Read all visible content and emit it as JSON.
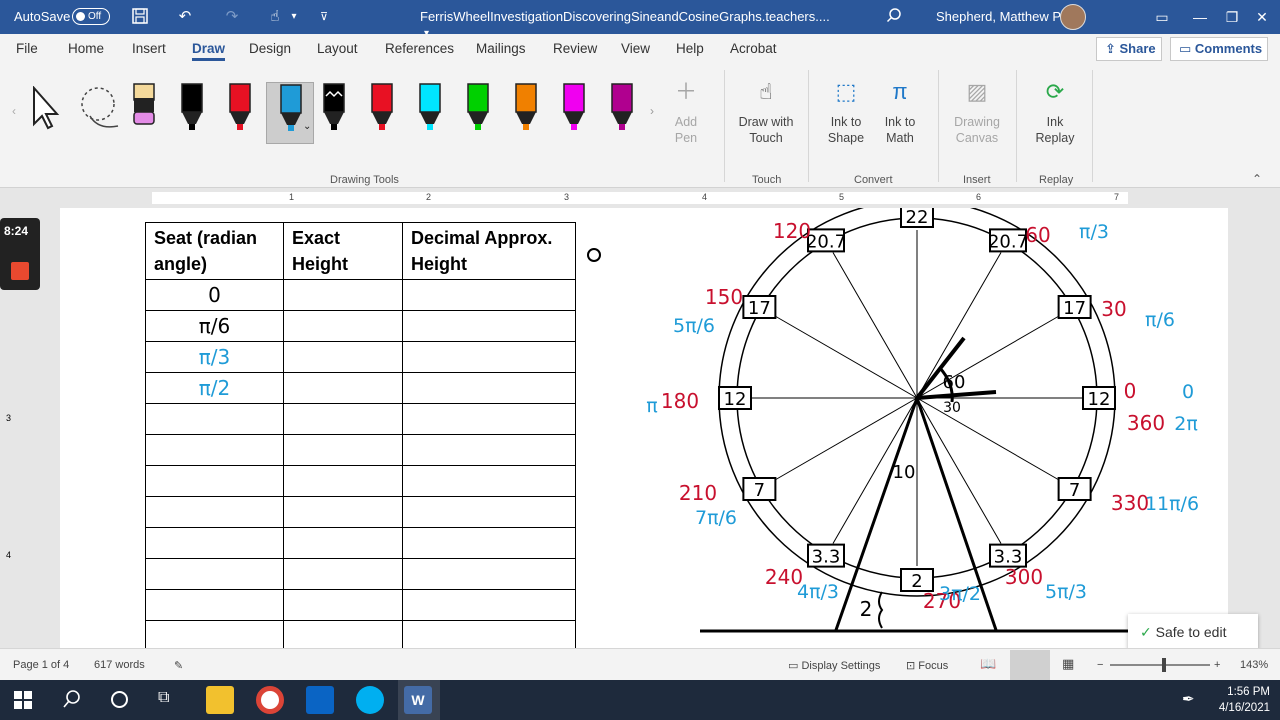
{
  "titlebar": {
    "autosave_label": "AutoSave",
    "autosave_state": "Off",
    "document_title": "FerrisWheelInvestigationDiscoveringSineandCosineGraphs.teachers....",
    "user_name": "Shepherd, Matthew P"
  },
  "tabs": [
    "File",
    "Home",
    "Insert",
    "Draw",
    "Design",
    "Layout",
    "References",
    "Mailings",
    "Review",
    "View",
    "Help",
    "Acrobat"
  ],
  "active_tab": "Draw",
  "share_label": "Share",
  "comments_label": "Comments",
  "ribbon": {
    "add_pen": "Add Pen",
    "draw_touch": "Draw with Touch",
    "ink_shape": "Ink to Shape",
    "ink_math": "Ink to Math",
    "drawing_canvas": "Drawing Canvas",
    "ink_replay": "Ink Replay",
    "groups": {
      "drawing_tools": "Drawing Tools",
      "touch": "Touch",
      "convert": "Convert",
      "insert": "Insert",
      "replay": "Replay"
    },
    "pen_colors": [
      "#000000",
      "#e81123",
      "#1f9bd7",
      "#000000",
      "#e81123",
      "#00e5ff",
      "#00d000",
      "#f08000",
      "#f000f0",
      "#b0008f"
    ]
  },
  "ruler_numbers": [
    "1",
    "2",
    "3",
    "4",
    "5",
    "6",
    "7"
  ],
  "vruler_numbers": [
    "3",
    "4"
  ],
  "timer": "8:24",
  "table": {
    "headers": [
      "Seat (radian angle)",
      "Exact Height",
      "Decimal Approx. Height"
    ],
    "rows": [
      "0",
      "π/6",
      "π/3",
      "π/2",
      "",
      "",
      "",
      "",
      "",
      "",
      "",
      ""
    ]
  },
  "wheel": {
    "seat_heights": {
      "top": "22",
      "upper_right": "20.7",
      "upper_left": "20.7",
      "right_high": "17",
      "left_high": "17",
      "right": "12",
      "left": "12",
      "right_low": "7",
      "left_low": "7",
      "lower_right": "3.3",
      "lower_left": "3.3",
      "bottom": "2"
    },
    "degree_labels": [
      "120",
      "60",
      "150",
      "30",
      "180",
      "0",
      "360",
      "210",
      "330",
      "240",
      "270",
      "300"
    ],
    "radian_labels": [
      "π/3",
      "5π/6",
      "π/6",
      "π",
      "0",
      "2π",
      "7π/6",
      "11π/6",
      "4π/3",
      "3π/2",
      "5π/3"
    ],
    "annotations": [
      "60",
      "30",
      "10",
      "2"
    ]
  },
  "toast": "Safe to edit",
  "status": {
    "page": "Page 1 of 4",
    "words": "617 words",
    "display_settings": "Display Settings",
    "focus": "Focus",
    "zoom": "143%"
  },
  "taskbar": {
    "time": "1:56 PM",
    "date": "4/16/2021"
  }
}
